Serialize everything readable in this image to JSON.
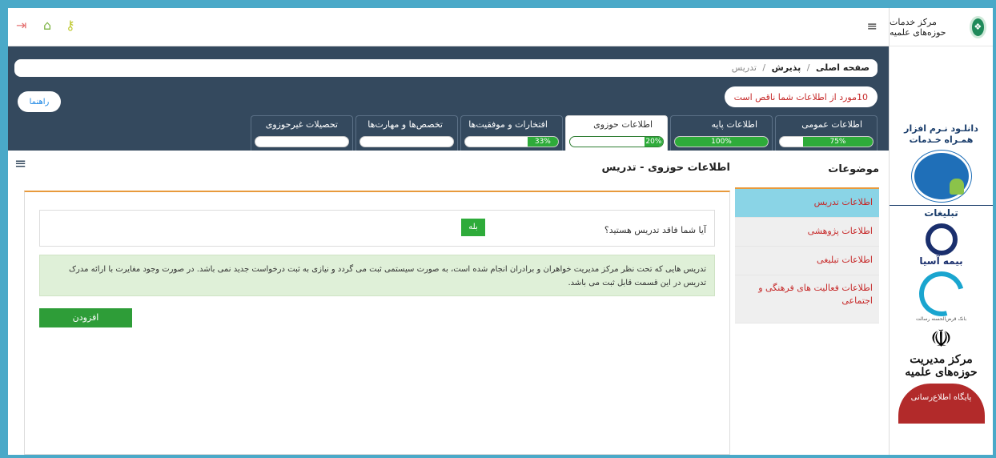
{
  "sidebar": {
    "logo_text": "مرکز خدمات حوزه‌های علمیه",
    "app_ad_line1": "دانلـود نـرم افزار",
    "app_ad_line2": "همـراه خـدمات",
    "ads_title": "تبلیغات",
    "asia_text": "بیمه آسیا",
    "swirl_caption": "بانک قرض‌الحسنه رسالت",
    "markaz_text": "مرکز مدیریت حوزه‌های علمیه",
    "badge_text": "پایگاه اطلاع‌رسانی"
  },
  "header": {
    "menu_icon": "≡",
    "exit_icon": "⇥",
    "home_icon": "⌂",
    "key_icon": "⚷"
  },
  "breadcrumb": {
    "home": "صفحه اصلی",
    "sep1": "/",
    "level2": "پذیرش",
    "sep2": "/",
    "current": "تدریس"
  },
  "alert": "10مورد از اطلاعات شما ناقص است",
  "help_label": "راهنما",
  "tabs": [
    {
      "label": "اطلاعات عمومی",
      "progress": "75%",
      "value": 75
    },
    {
      "label": "اطلاعات پایه",
      "progress": "100%",
      "value": 100
    },
    {
      "label": "اطلاعات حوزوی",
      "progress": "20%",
      "value": 20
    },
    {
      "label": "افتخارات و موفقیت‌ها",
      "progress": "33%",
      "value": 33
    },
    {
      "label": "تخصص‌ها و مهارت‌ها",
      "progress": "",
      "value": 0
    },
    {
      "label": "تحصیلات غیرحوزوی",
      "progress": "",
      "value": 0
    }
  ],
  "topics_title": "موضوعات",
  "section_title": "اطلاعات حوزوی - تدریس",
  "topics": [
    "اطلاعات تدریس",
    "اطلاعات پژوهشی",
    "اطلاعات تبلیغی",
    "اطلاعات فعالیت های فرهنگی و اجتماعی"
  ],
  "question": "آیا شما فاقد تدریس هستید؟",
  "yes_label": "بله",
  "info_text": "تدریس هایی که تحت نظر مرکز مدیریت خواهران و برادران انجام شده است، به صورت سیستمی ثبت می گردد و نیازی به ثبت درخواست جدید نمی باشد. در صورت وجود مغایرت با ارائه مدرک تدریس در این قسمت قابل ثبت می باشد.",
  "add_label": "افزودن"
}
